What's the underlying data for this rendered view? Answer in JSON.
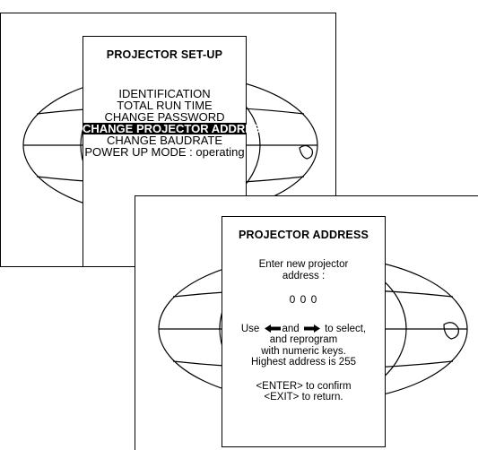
{
  "setup_menu": {
    "title": "PROJECTOR SET-UP",
    "items": [
      "IDENTIFICATION",
      "TOTAL RUN TIME",
      "CHANGE PASSWORD",
      "CHANGE PROJECTOR ADDRESS",
      "CHANGE BAUDRATE",
      "POWER UP MODE : operating"
    ],
    "selected_index": 3
  },
  "address_menu": {
    "title": "PROJECTOR ADDRESS",
    "prompt_line1": "Enter new projector",
    "prompt_line2": "address :",
    "value": "0 0 0",
    "help_use": "Use",
    "help_and": "and",
    "help_to_select": "to select,",
    "help_line2": "and reprogram",
    "help_line3": "with numeric keys.",
    "help_line4": "Highest address is 255",
    "enter_hint": "<ENTER> to confirm",
    "exit_hint": "<EXIT> to return."
  },
  "icons": {
    "background": "globe-icon",
    "left": "arrow-left-icon",
    "right": "arrow-right-icon"
  }
}
